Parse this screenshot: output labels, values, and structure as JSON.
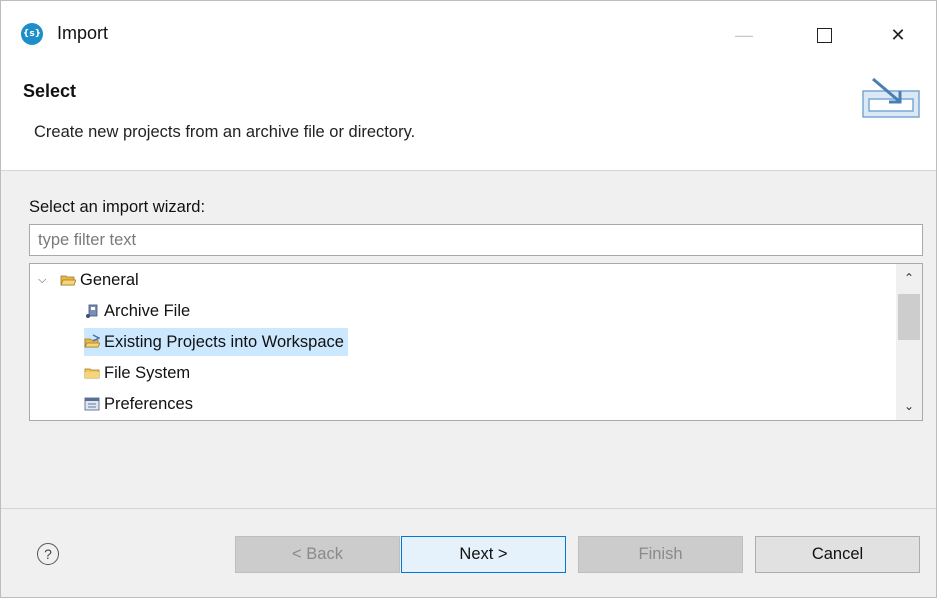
{
  "window": {
    "title": "Import",
    "app_icon_text": "{s}"
  },
  "banner": {
    "title": "Select",
    "description": "Create new projects from an archive file or directory."
  },
  "wizard": {
    "label": "Select an import wizard:",
    "filter_placeholder": "type filter text",
    "filter_value": "",
    "tree": {
      "group": "General",
      "items": [
        {
          "label": "Archive File",
          "icon": "archive-file-icon",
          "selected": false
        },
        {
          "label": "Existing Projects into Workspace",
          "icon": "project-folder-icon",
          "selected": true
        },
        {
          "label": "File System",
          "icon": "folder-icon",
          "selected": false
        },
        {
          "label": "Preferences",
          "icon": "preferences-icon",
          "selected": false
        }
      ]
    }
  },
  "footer": {
    "help_glyph": "?",
    "back_label": "< Back",
    "next_label": "Next >",
    "finish_label": "Finish",
    "cancel_label": "Cancel"
  },
  "colors": {
    "selection": "#cce8ff",
    "accent": "#0078d7",
    "app_icon": "#1c8fc9"
  }
}
